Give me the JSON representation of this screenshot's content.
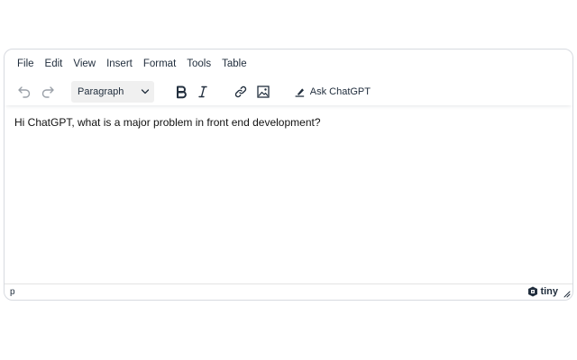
{
  "menubar": {
    "items": [
      "File",
      "Edit",
      "View",
      "Insert",
      "Format",
      "Tools",
      "Table"
    ]
  },
  "toolbar": {
    "undo_icon": "undo-icon",
    "redo_icon": "redo-icon",
    "block_format": "Paragraph",
    "bold_icon": "bold-icon",
    "italic_icon": "italic-icon",
    "link_icon": "link-icon",
    "image_icon": "image-icon",
    "ask_chatgpt_label": "Ask ChatGPT",
    "ask_chatgpt_icon": "highlighter-pen-icon"
  },
  "content": {
    "text": "Hi ChatGPT, what is a major problem in front end development?"
  },
  "statusbar": {
    "path": "p",
    "branding": "tiny"
  }
}
